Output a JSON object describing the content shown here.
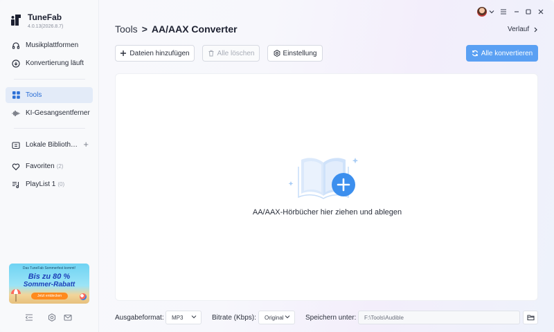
{
  "brand": {
    "name": "TuneFab",
    "version": "4.0.13(2026.8.7)"
  },
  "sidebar": {
    "items": [
      {
        "label": "Musikplattformen",
        "icon": "headphones-icon"
      },
      {
        "label": "Konvertierung läuft",
        "icon": "download-circle-icon"
      },
      {
        "label": "Tools",
        "icon": "grid-icon",
        "active": true
      },
      {
        "label": "KI-Gesangsentferner",
        "icon": "waveform-icon"
      },
      {
        "label": "Lokale Biblioth…",
        "icon": "library-icon"
      },
      {
        "label": "Favoriten",
        "count": "(2)",
        "icon": "heart-icon"
      },
      {
        "label": "PlayList 1",
        "count": "(0)",
        "icon": "playlist-icon"
      }
    ],
    "add_library": "+",
    "promo": {
      "top": "Das TuneFab Sommerfest kommt!",
      "headline_line1": "Bis zu 80 %",
      "headline_line2": "Sommer-Rabatt",
      "button": "Jetzt entdecken"
    }
  },
  "header": {
    "breadcrumb_root": "Tools",
    "breadcrumb_sep": ">",
    "breadcrumb_current": "AA/AAX Converter",
    "history": "Verlauf"
  },
  "toolbar": {
    "add_files": "Dateien hinzufügen",
    "clear_all": "Alle löschen",
    "settings": "Einstellung",
    "convert_all": "Alle konvertieren"
  },
  "dropzone": {
    "text": "AA/AAX-Hörbücher hier ziehen und ablegen"
  },
  "bottom": {
    "format_label": "Ausgabeformat:",
    "format_value": "MP3",
    "bitrate_label": "Bitrate (Kbps):",
    "bitrate_value": "Original",
    "save_label": "Speichern unter:",
    "save_path": "F:\\Tools\\Audible"
  },
  "colors": {
    "accent": "#5aa0f3",
    "active_bg": "#e3ebf8",
    "active_text": "#2b6fd6"
  }
}
